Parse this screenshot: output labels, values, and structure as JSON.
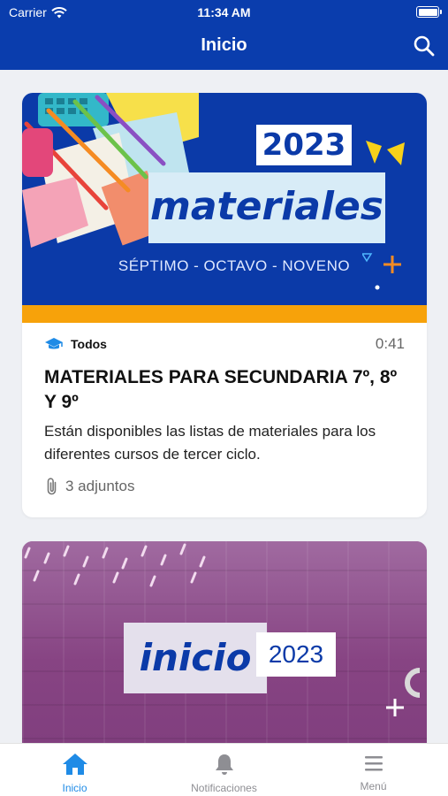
{
  "status_bar": {
    "carrier": "Carrier",
    "time": "11:34 AM"
  },
  "nav": {
    "title": "Inicio",
    "search_icon": "search-icon"
  },
  "posts": [
    {
      "banner": {
        "year": "2023",
        "word": "materiales",
        "grades": "SÉPTIMO - OCTAVO - NOVENO"
      },
      "audience": "Todos",
      "time": "0:41",
      "title": "MATERIALES PARA SECUNDARIA 7º, 8º Y 9º",
      "description": "Están disponibles las listas de materiales para los diferentes cursos de tercer ciclo.",
      "attachments": "3 adjuntos"
    },
    {
      "banner": {
        "word": "inicio",
        "year": "2023"
      }
    }
  ],
  "tabs": [
    {
      "label": "Inicio",
      "icon": "home-icon",
      "active": true
    },
    {
      "label": "Notificaciones",
      "icon": "bell-icon",
      "active": false
    },
    {
      "label": "Menú",
      "icon": "menu-icon",
      "active": false
    }
  ],
  "colors": {
    "brand": "#0a3dad",
    "accent": "#1f8be6",
    "banner_orange": "#f7a20a",
    "banner_purple": "#8a3f86"
  }
}
